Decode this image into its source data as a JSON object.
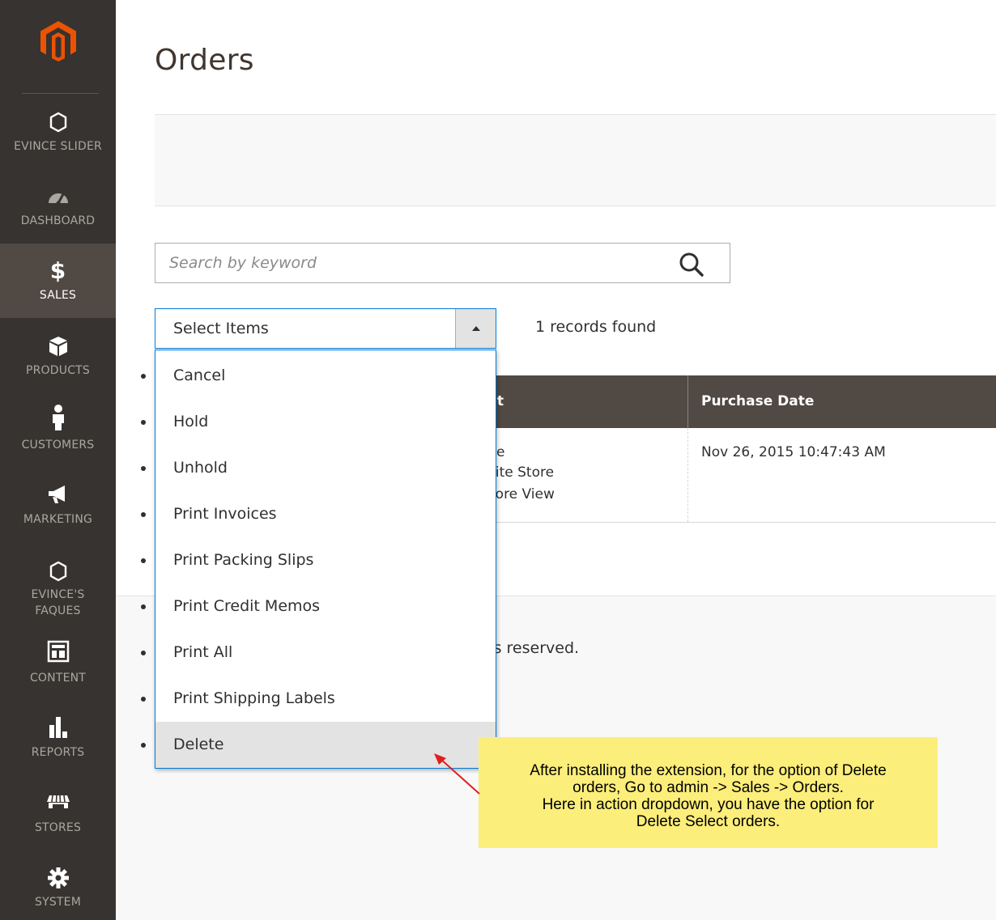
{
  "sidebar": {
    "logo": "magento-logo-icon",
    "items": [
      {
        "label": "EVINCE SLIDER",
        "icon": "hexagon-icon"
      },
      {
        "label": "DASHBOARD",
        "icon": "speedometer-icon"
      },
      {
        "label": "SALES",
        "icon": "dollar-icon",
        "active": true
      },
      {
        "label": "PRODUCTS",
        "icon": "cube-icon"
      },
      {
        "label": "CUSTOMERS",
        "icon": "person-icon"
      },
      {
        "label": "MARKETING",
        "icon": "megaphone-icon"
      },
      {
        "label_line1": "EVINCE'S",
        "label_line2": "FAQUES",
        "icon": "hexagon-icon"
      },
      {
        "label": "CONTENT",
        "icon": "layout-icon"
      },
      {
        "label": "REPORTS",
        "icon": "bar-chart-icon"
      },
      {
        "label": "STORES",
        "icon": "storefront-icon"
      },
      {
        "label": "SYSTEM",
        "icon": "gear-icon"
      }
    ]
  },
  "page": {
    "title": "Orders"
  },
  "search": {
    "placeholder": "Search by keyword",
    "icon": "search-icon"
  },
  "actions": {
    "label": "Select Items",
    "options": [
      "Cancel",
      "Hold",
      "Unhold",
      "Print Invoices",
      "Print Packing Slips",
      "Print Credit Memos",
      "Print All",
      "Print Shipping Labels",
      "Delete"
    ],
    "hovered": "Delete"
  },
  "records_found": "1 records found",
  "table": {
    "headers": [
      "int",
      "Purchase Date"
    ],
    "row": {
      "purchase_point_lines": [
        "e",
        "site Store",
        "tore View"
      ],
      "purchase_date": "Nov 26, 2015 10:47:43 AM"
    }
  },
  "footer": {
    "copyright": "ce Inc. All rights reserved."
  },
  "callout": {
    "lines": [
      "After installing the extension, for the option of Delete",
      "orders, Go to admin -> Sales -> Orders.",
      "Here in action dropdown, you have the option for",
      "Delete Select orders."
    ],
    "background": "#fcee7a",
    "arrow_color": "#e02020"
  },
  "colors": {
    "sidebar_bg": "#373330",
    "sidebar_active_bg": "#514943",
    "table_header_bg": "#514943",
    "focus_blue": "#007bdb"
  }
}
